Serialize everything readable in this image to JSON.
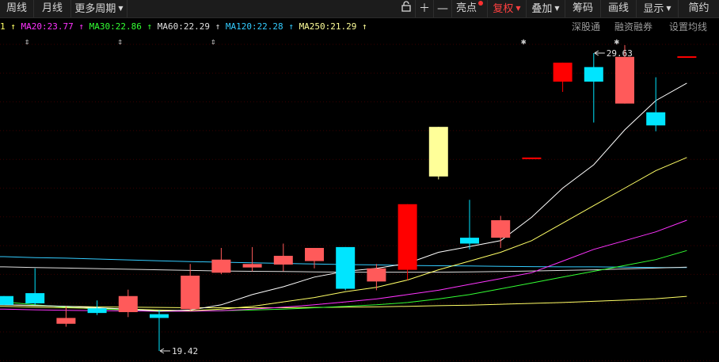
{
  "toolbar": {
    "weekly": "周线",
    "monthly": "月线",
    "more_periods": "更多周期",
    "highlight": "亮点",
    "adjust": "复权",
    "overlay": "叠加",
    "chips": "筹码",
    "draw": "画线",
    "display": "显示",
    "brief": "简约"
  },
  "ma_legend": {
    "lead": "1",
    "ma20": "MA20:23.77",
    "ma30": "MA30:22.86",
    "ma60": "MA60:22.29",
    "ma120": "MA120:22.28",
    "ma250": "MA250:21.29"
  },
  "right_links": {
    "hk_connect": "深股通",
    "margin": "融资融券",
    "ma_settings": "设置均线"
  },
  "colors": {
    "up": "#ff5a5a",
    "up_solid": "#ff0000",
    "down": "#00e5ff",
    "limit": "#ffff99",
    "ma5": "#ffffff",
    "ma10": "#ffff66",
    "ma20": "#ff33ff",
    "ma30": "#33ff33",
    "ma60": "#dddddd",
    "ma120": "#33ccff",
    "ma250": "#ffff66"
  },
  "chart_data": {
    "type": "candlestick",
    "y_range": [
      18.6,
      31.2
    ],
    "candles": [
      {
        "o": 21.0,
        "c": 21.3,
        "h": 21.3,
        "l": 21.0,
        "color": "down"
      },
      {
        "o": 21.4,
        "c": 21.05,
        "h": 22.25,
        "l": 21.0,
        "color": "down"
      },
      {
        "o": 20.35,
        "c": 20.55,
        "h": 20.95,
        "l": 20.25,
        "color": "up"
      },
      {
        "o": 20.88,
        "c": 20.72,
        "h": 21.15,
        "l": 20.65,
        "color": "down"
      },
      {
        "o": 20.75,
        "c": 21.3,
        "h": 21.52,
        "l": 20.58,
        "color": "up"
      },
      {
        "o": 20.68,
        "c": 20.55,
        "h": 20.82,
        "l": 19.42,
        "color": "down"
      },
      {
        "o": 20.85,
        "c": 22.0,
        "h": 22.4,
        "l": 20.8,
        "color": "up"
      },
      {
        "o": 22.1,
        "c": 22.55,
        "h": 22.95,
        "l": 22.05,
        "color": "up"
      },
      {
        "o": 22.28,
        "c": 22.4,
        "h": 22.98,
        "l": 22.15,
        "color": "up"
      },
      {
        "o": 22.38,
        "c": 22.68,
        "h": 23.1,
        "l": 22.15,
        "color": "up"
      },
      {
        "o": 22.5,
        "c": 22.95,
        "h": 22.95,
        "l": 22.25,
        "color": "up"
      },
      {
        "o": 22.98,
        "c": 21.55,
        "h": 22.98,
        "l": 21.5,
        "color": "down"
      },
      {
        "o": 21.8,
        "c": 22.25,
        "h": 22.4,
        "l": 21.5,
        "color": "up"
      },
      {
        "o": 22.2,
        "c": 24.45,
        "h": 24.45,
        "l": 21.85,
        "color": "up_solid"
      },
      {
        "o": 25.4,
        "c": 27.1,
        "h": 27.1,
        "l": 25.3,
        "color": "limit"
      },
      {
        "o": 23.3,
        "c": 23.1,
        "h": 24.6,
        "l": 22.9,
        "color": "down"
      },
      {
        "o": 23.3,
        "c": 23.9,
        "h": 24.05,
        "l": 22.95,
        "color": "up"
      },
      {
        "o": 26.05,
        "c": 26.05,
        "h": 26.05,
        "l": 26.05,
        "color": "up_solid"
      },
      {
        "o": 28.65,
        "c": 29.3,
        "h": 29.3,
        "l": 28.3,
        "color": "up_solid"
      },
      {
        "o": 29.15,
        "c": 28.65,
        "h": 29.63,
        "l": 27.25,
        "color": "down"
      },
      {
        "o": 27.9,
        "c": 29.5,
        "h": 29.9,
        "l": 27.9,
        "color": "up"
      },
      {
        "o": 27.6,
        "c": 27.15,
        "h": 28.8,
        "l": 26.95,
        "color": "down"
      },
      {
        "o": 29.52,
        "c": 29.52,
        "h": 29.52,
        "l": 29.52,
        "color": "up_solid"
      }
    ],
    "ma_lines": {
      "ma5": [
        21.0,
        20.98,
        20.95,
        20.9,
        20.85,
        20.78,
        20.82,
        21.0,
        21.35,
        21.62,
        21.95,
        22.15,
        22.25,
        22.42,
        22.8,
        23.0,
        23.2,
        24.0,
        25.0,
        25.8,
        27.0,
        28.0,
        28.6
      ],
      "ma10": [
        20.95,
        20.92,
        20.9,
        20.88,
        20.85,
        20.82,
        20.8,
        20.85,
        20.95,
        21.1,
        21.25,
        21.45,
        21.6,
        21.85,
        22.2,
        22.5,
        22.8,
        23.2,
        23.8,
        24.4,
        25.0,
        25.6,
        26.05
      ],
      "ma20": [
        20.85,
        20.83,
        20.81,
        20.8,
        20.79,
        20.78,
        20.78,
        20.8,
        20.85,
        20.92,
        21.0,
        21.1,
        21.2,
        21.35,
        21.5,
        21.7,
        21.9,
        22.1,
        22.5,
        22.9,
        23.2,
        23.5,
        23.9
      ],
      "ma30": [
        21.1,
        21.0,
        20.92,
        20.86,
        20.82,
        20.8,
        20.8,
        20.8,
        20.82,
        20.85,
        20.9,
        20.95,
        21.0,
        21.08,
        21.2,
        21.35,
        21.55,
        21.75,
        21.95,
        22.15,
        22.35,
        22.55,
        22.86
      ],
      "ma60": [
        22.3,
        22.28,
        22.26,
        22.24,
        22.22,
        22.2,
        22.18,
        22.16,
        22.15,
        22.14,
        22.13,
        22.12,
        22.12,
        22.12,
        22.12,
        22.13,
        22.14,
        22.16,
        22.18,
        22.2,
        22.23,
        22.26,
        22.29
      ],
      "ma120": [
        22.65,
        22.62,
        22.6,
        22.57,
        22.54,
        22.51,
        22.48,
        22.46,
        22.44,
        22.42,
        22.4,
        22.38,
        22.37,
        22.35,
        22.34,
        22.33,
        22.32,
        22.31,
        22.3,
        22.3,
        22.29,
        22.28,
        22.28
      ],
      "ma250": [
        21.0,
        20.97,
        20.95,
        20.93,
        20.92,
        20.91,
        20.9,
        20.9,
        20.9,
        20.9,
        20.91,
        20.92,
        20.93,
        20.95,
        20.97,
        20.99,
        21.02,
        21.05,
        21.08,
        21.12,
        21.16,
        21.21,
        21.29
      ]
    },
    "annotations": {
      "high_label": "29.63",
      "low_label": "19.42",
      "high_index": 19,
      "low_index": 5,
      "high_value": 29.63,
      "low_value": 19.42
    },
    "event_markers": [
      {
        "index": 0,
        "symbol": "⇕"
      },
      {
        "index": 3,
        "symbol": "⇕"
      },
      {
        "index": 6,
        "symbol": "⇕"
      },
      {
        "index": 16,
        "symbol": "✱"
      },
      {
        "index": 19,
        "symbol": "✱"
      }
    ]
  }
}
